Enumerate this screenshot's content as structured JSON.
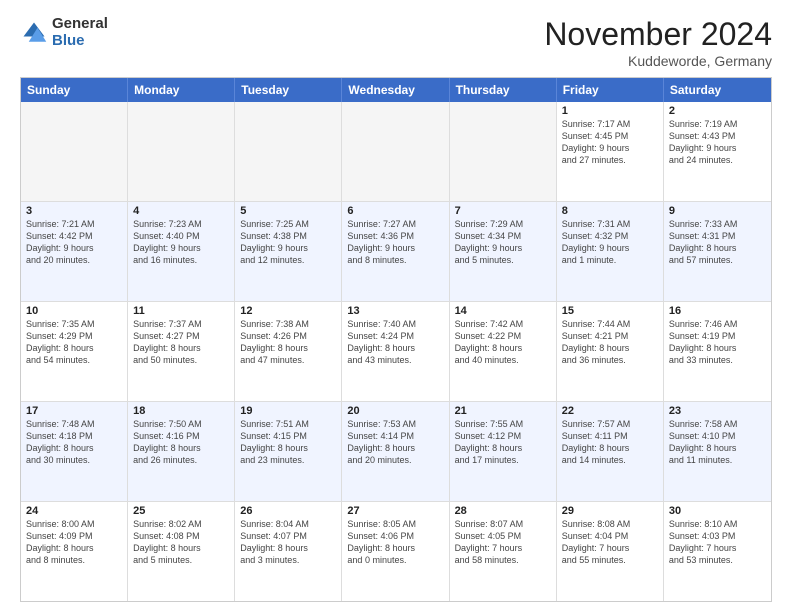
{
  "header": {
    "logo_general": "General",
    "logo_blue": "Blue",
    "month_title": "November 2024",
    "location": "Kuddeworde, Germany"
  },
  "weekdays": [
    "Sunday",
    "Monday",
    "Tuesday",
    "Wednesday",
    "Thursday",
    "Friday",
    "Saturday"
  ],
  "rows": [
    [
      {
        "day": "",
        "info": "",
        "empty": true
      },
      {
        "day": "",
        "info": "",
        "empty": true
      },
      {
        "day": "",
        "info": "",
        "empty": true
      },
      {
        "day": "",
        "info": "",
        "empty": true
      },
      {
        "day": "",
        "info": "",
        "empty": true
      },
      {
        "day": "1",
        "info": "Sunrise: 7:17 AM\nSunset: 4:45 PM\nDaylight: 9 hours\nand 27 minutes."
      },
      {
        "day": "2",
        "info": "Sunrise: 7:19 AM\nSunset: 4:43 PM\nDaylight: 9 hours\nand 24 minutes."
      }
    ],
    [
      {
        "day": "3",
        "info": "Sunrise: 7:21 AM\nSunset: 4:42 PM\nDaylight: 9 hours\nand 20 minutes."
      },
      {
        "day": "4",
        "info": "Sunrise: 7:23 AM\nSunset: 4:40 PM\nDaylight: 9 hours\nand 16 minutes."
      },
      {
        "day": "5",
        "info": "Sunrise: 7:25 AM\nSunset: 4:38 PM\nDaylight: 9 hours\nand 12 minutes."
      },
      {
        "day": "6",
        "info": "Sunrise: 7:27 AM\nSunset: 4:36 PM\nDaylight: 9 hours\nand 8 minutes."
      },
      {
        "day": "7",
        "info": "Sunrise: 7:29 AM\nSunset: 4:34 PM\nDaylight: 9 hours\nand 5 minutes."
      },
      {
        "day": "8",
        "info": "Sunrise: 7:31 AM\nSunset: 4:32 PM\nDaylight: 9 hours\nand 1 minute."
      },
      {
        "day": "9",
        "info": "Sunrise: 7:33 AM\nSunset: 4:31 PM\nDaylight: 8 hours\nand 57 minutes."
      }
    ],
    [
      {
        "day": "10",
        "info": "Sunrise: 7:35 AM\nSunset: 4:29 PM\nDaylight: 8 hours\nand 54 minutes."
      },
      {
        "day": "11",
        "info": "Sunrise: 7:37 AM\nSunset: 4:27 PM\nDaylight: 8 hours\nand 50 minutes."
      },
      {
        "day": "12",
        "info": "Sunrise: 7:38 AM\nSunset: 4:26 PM\nDaylight: 8 hours\nand 47 minutes."
      },
      {
        "day": "13",
        "info": "Sunrise: 7:40 AM\nSunset: 4:24 PM\nDaylight: 8 hours\nand 43 minutes."
      },
      {
        "day": "14",
        "info": "Sunrise: 7:42 AM\nSunset: 4:22 PM\nDaylight: 8 hours\nand 40 minutes."
      },
      {
        "day": "15",
        "info": "Sunrise: 7:44 AM\nSunset: 4:21 PM\nDaylight: 8 hours\nand 36 minutes."
      },
      {
        "day": "16",
        "info": "Sunrise: 7:46 AM\nSunset: 4:19 PM\nDaylight: 8 hours\nand 33 minutes."
      }
    ],
    [
      {
        "day": "17",
        "info": "Sunrise: 7:48 AM\nSunset: 4:18 PM\nDaylight: 8 hours\nand 30 minutes."
      },
      {
        "day": "18",
        "info": "Sunrise: 7:50 AM\nSunset: 4:16 PM\nDaylight: 8 hours\nand 26 minutes."
      },
      {
        "day": "19",
        "info": "Sunrise: 7:51 AM\nSunset: 4:15 PM\nDaylight: 8 hours\nand 23 minutes."
      },
      {
        "day": "20",
        "info": "Sunrise: 7:53 AM\nSunset: 4:14 PM\nDaylight: 8 hours\nand 20 minutes."
      },
      {
        "day": "21",
        "info": "Sunrise: 7:55 AM\nSunset: 4:12 PM\nDaylight: 8 hours\nand 17 minutes."
      },
      {
        "day": "22",
        "info": "Sunrise: 7:57 AM\nSunset: 4:11 PM\nDaylight: 8 hours\nand 14 minutes."
      },
      {
        "day": "23",
        "info": "Sunrise: 7:58 AM\nSunset: 4:10 PM\nDaylight: 8 hours\nand 11 minutes."
      }
    ],
    [
      {
        "day": "24",
        "info": "Sunrise: 8:00 AM\nSunset: 4:09 PM\nDaylight: 8 hours\nand 8 minutes."
      },
      {
        "day": "25",
        "info": "Sunrise: 8:02 AM\nSunset: 4:08 PM\nDaylight: 8 hours\nand 5 minutes."
      },
      {
        "day": "26",
        "info": "Sunrise: 8:04 AM\nSunset: 4:07 PM\nDaylight: 8 hours\nand 3 minutes."
      },
      {
        "day": "27",
        "info": "Sunrise: 8:05 AM\nSunset: 4:06 PM\nDaylight: 8 hours\nand 0 minutes."
      },
      {
        "day": "28",
        "info": "Sunrise: 8:07 AM\nSunset: 4:05 PM\nDaylight: 7 hours\nand 58 minutes."
      },
      {
        "day": "29",
        "info": "Sunrise: 8:08 AM\nSunset: 4:04 PM\nDaylight: 7 hours\nand 55 minutes."
      },
      {
        "day": "30",
        "info": "Sunrise: 8:10 AM\nSunset: 4:03 PM\nDaylight: 7 hours\nand 53 minutes."
      }
    ]
  ]
}
